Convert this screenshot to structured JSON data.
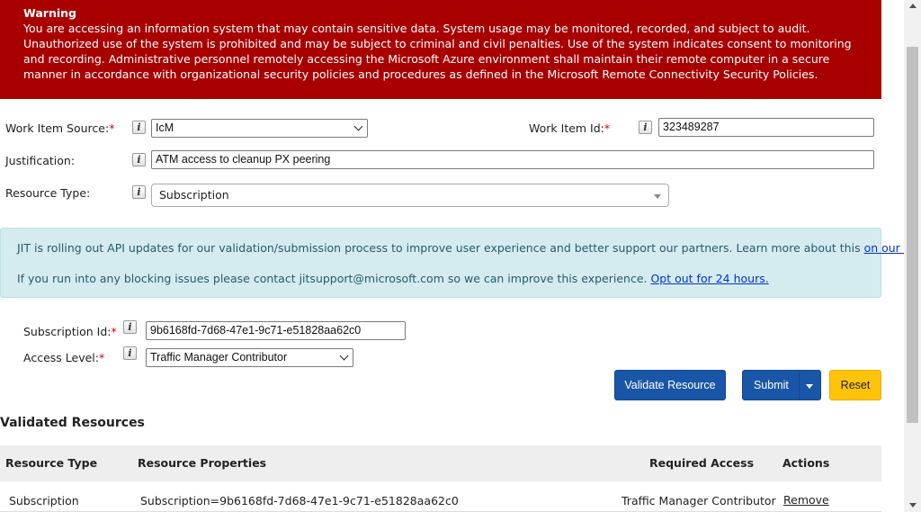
{
  "warning": {
    "title": "Warning",
    "body": "You are accessing an information system that may contain sensitive data. System usage may be monitored, recorded, and subject to audit. Unauthorized use of the system is prohibited and may be subject to criminal and civil penalties. Use of the system indicates consent to monitoring and recording. Administrative personnel remotely accessing the Microsoft Azure environment shall maintain their remote computer in a secure manner in accordance with organizational security policies and procedures as defined in the Microsoft Remote Connectivity Security Policies."
  },
  "form": {
    "work_item_source_label": "Work Item Source:",
    "work_item_source_value": "IcM",
    "work_item_id_label": "Work Item Id:",
    "work_item_id_value": "323489287",
    "justification_label": "Justification:",
    "justification_value": "ATM access to cleanup PX peering",
    "resource_type_label": "Resource Type:",
    "resource_type_value": "Subscription",
    "required_marker": "*",
    "info_icon_glyph": "i"
  },
  "notice": {
    "line1_text": "JIT is rolling out API updates for our validation/submission process to improve user experience and better support our partners. Learn more about this ",
    "line1_link": "on our wiki",
    "line2_text": "If you run into any blocking issues please contact jitsupport@microsoft.com so we can improve this experience. ",
    "line2_link": "Opt out for 24 hours."
  },
  "resource": {
    "subscription_id_label": "Subscription Id:",
    "subscription_id_value": "9b6168fd-7d68-47e1-9c71-e51828aa62c0",
    "access_level_label": "Access Level:",
    "access_level_value": "Traffic Manager Contributor"
  },
  "buttons": {
    "validate": "Validate Resource",
    "submit": "Submit",
    "reset": "Reset"
  },
  "validated": {
    "title": "Validated Resources",
    "headers": {
      "resource_type": "Resource Type",
      "resource_properties": "Resource Properties",
      "required_access": "Required Access",
      "actions": "Actions"
    },
    "rows": [
      {
        "resource_type": "Subscription",
        "resource_properties": "Subscription=9b6168fd-7d68-47e1-9c71-e51828aa62c0",
        "required_access": "Traffic Manager Contributor",
        "action": "Remove"
      }
    ]
  },
  "colors": {
    "warning_bg": "#a80000",
    "notice_bg": "#d4ecf0",
    "primary": "#1a56a7",
    "reset": "#ffc40a"
  }
}
